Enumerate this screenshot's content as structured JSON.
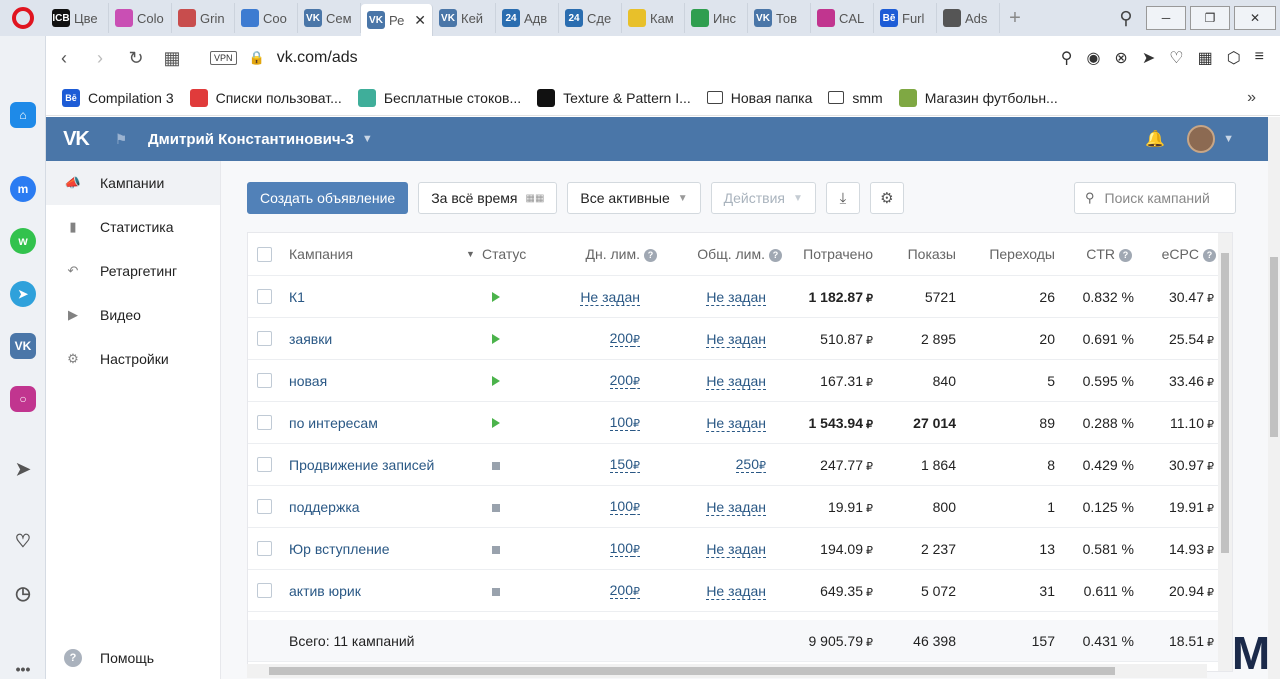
{
  "browser": {
    "tabs": [
      {
        "label": "Цве",
        "icon": "icb-favicon",
        "icon_text": "ICB",
        "color": "#111111"
      },
      {
        "label": "Colo",
        "icon": "color-wheel-favicon",
        "icon_text": "",
        "color": "#c94fb4"
      },
      {
        "label": "Grin",
        "icon": "grin-favicon",
        "icon_text": "",
        "color": "#c84d4d"
      },
      {
        "label": "Coo",
        "icon": "chat-favicon",
        "icon_text": "",
        "color": "#3d7bd1"
      },
      {
        "label": "Сем",
        "icon": "vk-favicon",
        "icon_text": "VK",
        "color": "#4a76a8"
      },
      {
        "label": "Ре",
        "icon": "vk-favicon",
        "icon_text": "VK",
        "color": "#4a76a8",
        "active": true
      },
      {
        "label": "Кей",
        "icon": "vk-favicon",
        "icon_text": "VK",
        "color": "#4a76a8"
      },
      {
        "label": "Адв",
        "icon": "24-favicon",
        "icon_text": "24",
        "color": "#2a6db0"
      },
      {
        "label": "Сде",
        "icon": "24-favicon",
        "icon_text": "24",
        "color": "#2a6db0"
      },
      {
        "label": "Кам",
        "icon": "notes-favicon",
        "icon_text": "",
        "color": "#e8c02a"
      },
      {
        "label": "Инс",
        "icon": "ads-favicon",
        "icon_text": "",
        "color": "#2f9e4f"
      },
      {
        "label": "Тов",
        "icon": "vk-favicon",
        "icon_text": "VK",
        "color": "#4a76a8"
      },
      {
        "label": "CAL",
        "icon": "instagram-favicon",
        "icon_text": "",
        "color": "#c1358f"
      },
      {
        "label": "Furl",
        "icon": "behance-favicon",
        "icon_text": "Bē",
        "color": "#1d5cd6"
      },
      {
        "label": "Ads",
        "icon": "doc-favicon",
        "icon_text": "",
        "color": "#555555"
      }
    ],
    "url": "vk.com/ads",
    "vpn_label": "VPN",
    "bookmarks": [
      {
        "label": "Compilation 3",
        "icon": "behance-icon",
        "icon_text": "Bē",
        "color": "#1d5cd6"
      },
      {
        "label": "Списки пользоват...",
        "icon": "target-icon",
        "icon_text": "",
        "color": "#e03b3b"
      },
      {
        "label": "Бесплатные стоков...",
        "icon": "stock-icon",
        "icon_text": "",
        "color": "#3fae9a"
      },
      {
        "label": "Texture & Pattern I...",
        "icon": "texture-icon",
        "icon_text": "",
        "color": "#111111"
      },
      {
        "label": "Новая папка",
        "icon": "folder-icon",
        "icon_text": "",
        "color": ""
      },
      {
        "label": "smm",
        "icon": "folder-icon",
        "icon_text": "",
        "color": ""
      },
      {
        "label": "Магазин футбольн...",
        "icon": "shop-icon",
        "icon_text": "",
        "color": "#7fa843"
      }
    ]
  },
  "header": {
    "account_name": "Дмитрий Константинович-3"
  },
  "menu": {
    "items": [
      {
        "label": "Кампании",
        "icon": "megaphone-icon",
        "active": true
      },
      {
        "label": "Статистика",
        "icon": "bar-chart-icon"
      },
      {
        "label": "Ретаргетинг",
        "icon": "retarget-icon"
      },
      {
        "label": "Видео",
        "icon": "video-icon"
      },
      {
        "label": "Настройки",
        "icon": "gear-icon"
      }
    ],
    "help": "Помощь"
  },
  "toolbar": {
    "create_label": "Создать объявление",
    "period_label": "За всё время",
    "filter_label": "Все активные",
    "actions_label": "Действия",
    "search_placeholder": "Поиск кампаний"
  },
  "table": {
    "headers": {
      "name": "Кампания",
      "status": "Статус",
      "day_limit": "Дн. лим.",
      "total_limit": "Общ. лим.",
      "spent": "Потрачено",
      "shows": "Показы",
      "clicks": "Переходы",
      "ctr": "CTR",
      "ecpc": "eCPC"
    },
    "currency": "₽",
    "rows": [
      {
        "name": "К1",
        "status": "active",
        "day_limit": "Не задан",
        "total_limit": "Не задан",
        "spent": "1 182.87",
        "shows": "5721",
        "clicks": "26",
        "ctr": "0.832 %",
        "ecpc": "30.47",
        "bold": true
      },
      {
        "name": "заявки",
        "status": "active",
        "day_limit": "200",
        "total_limit": "Не задан",
        "spent": "510.87",
        "shows": "2 895",
        "clicks": "20",
        "ctr": "0.691 %",
        "ecpc": "25.54"
      },
      {
        "name": "новая",
        "status": "active",
        "day_limit": "200",
        "total_limit": "Не задан",
        "spent": "167.31",
        "shows": "840",
        "clicks": "5",
        "ctr": "0.595 %",
        "ecpc": "33.46"
      },
      {
        "name": "по интересам",
        "status": "active",
        "day_limit": "100",
        "total_limit": "Не задан",
        "spent": "1 543.94",
        "shows": "27 014",
        "clicks": "89",
        "ctr": "0.288 %",
        "ecpc": "11.10",
        "bold": true
      },
      {
        "name": "Продвижение записей",
        "status": "stopped",
        "day_limit": "150",
        "total_limit": "250",
        "spent": "247.77",
        "shows": "1 864",
        "clicks": "8",
        "ctr": "0.429 %",
        "ecpc": "30.97"
      },
      {
        "name": "поддержка",
        "status": "stopped",
        "day_limit": "100",
        "total_limit": "Не задан",
        "spent": "19.91",
        "shows": "800",
        "clicks": "1",
        "ctr": "0.125 %",
        "ecpc": "19.91"
      },
      {
        "name": "Юр вступление",
        "status": "stopped",
        "day_limit": "100",
        "total_limit": "Не задан",
        "spent": "194.09",
        "shows": "2 237",
        "clicks": "13",
        "ctr": "0.581 %",
        "ecpc": "14.93"
      },
      {
        "name": "актив юрик",
        "status": "stopped",
        "day_limit": "200",
        "total_limit": "Не задан",
        "spent": "649.35",
        "shows": "5 072",
        "clicks": "31",
        "ctr": "0.611 %",
        "ecpc": "20.94"
      }
    ],
    "total": {
      "label": "Всего: 11 кампаний",
      "spent": "9 905.79",
      "shows": "46 398",
      "clicks": "157",
      "ctr": "0.431 %",
      "ecpc": "18.51"
    }
  },
  "colors": {
    "vk_blue": "#4a76a8",
    "button_blue": "#5181b8",
    "link": "#2a5885",
    "active_green": "#4bb34b"
  }
}
